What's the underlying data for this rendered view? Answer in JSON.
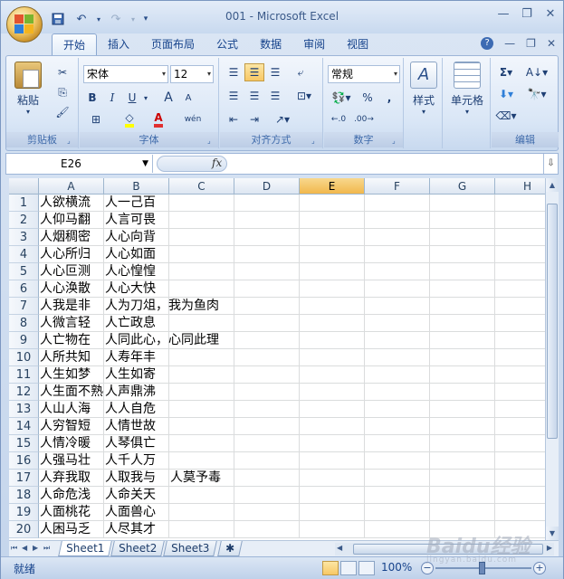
{
  "window": {
    "title": "001 - Microsoft Excel",
    "minimize": "—",
    "restore": "❐",
    "close": "✕"
  },
  "qat": {
    "save_icon": "save-icon",
    "undo_icon": "undo-icon",
    "redo_icon": "redo-icon",
    "customize_icon": "customize-icon"
  },
  "tabs": [
    "开始",
    "插入",
    "页面布局",
    "公式",
    "数据",
    "审阅",
    "视图"
  ],
  "active_tab": "开始",
  "tab_right": {
    "help": "?",
    "min": "—",
    "restore": "❐",
    "close": "✕"
  },
  "ribbon": {
    "clipboard": {
      "label": "剪贴板",
      "paste": "粘贴"
    },
    "font": {
      "label": "字体",
      "name": "宋体",
      "size": "12",
      "bold": "B",
      "italic": "I",
      "underline": "U",
      "grow": "A",
      "shrink": "A",
      "color_letter": "A",
      "wen": "wén"
    },
    "alignment": {
      "label": "对齐方式"
    },
    "number": {
      "label": "数字",
      "format": "常规",
      "percent": "%",
      "comma": ","
    },
    "styles": {
      "label": "样式"
    },
    "cells": {
      "label": "单元格"
    },
    "editing": {
      "label": "编辑",
      "sigma": "Σ"
    }
  },
  "formula_bar": {
    "name_box": "E26",
    "fx": "fx",
    "value": ""
  },
  "columns": [
    "A",
    "B",
    "C",
    "D",
    "E",
    "F",
    "G",
    "H"
  ],
  "selected_column": "E",
  "rows": [
    {
      "n": "1",
      "a": "人欲横流",
      "b": "人一己百"
    },
    {
      "n": "2",
      "a": "人仰马翻",
      "b": "人言可畏"
    },
    {
      "n": "3",
      "a": "人烟稠密",
      "b": "人心向背"
    },
    {
      "n": "4",
      "a": "人心所归",
      "b": "人心如面"
    },
    {
      "n": "5",
      "a": "人心叵测",
      "b": "人心惶惶"
    },
    {
      "n": "6",
      "a": "人心涣散",
      "b": "人心大快"
    },
    {
      "n": "7",
      "a": "人我是非",
      "b": "人为刀俎，我为鱼肉"
    },
    {
      "n": "8",
      "a": "人微言轻",
      "b": "人亡政息"
    },
    {
      "n": "9",
      "a": "人亡物在",
      "b": "人同此心，心同此理"
    },
    {
      "n": "10",
      "a": "人所共知",
      "b": "人寿年丰"
    },
    {
      "n": "11",
      "a": "人生如梦",
      "b": "人生如寄"
    },
    {
      "n": "12",
      "a": "人生面不熟",
      "b": "人声鼎沸"
    },
    {
      "n": "13",
      "a": "人山人海",
      "b": "人人自危"
    },
    {
      "n": "14",
      "a": "人穷智短",
      "b": "人情世故"
    },
    {
      "n": "15",
      "a": "人情冷暖",
      "b": "人琴俱亡"
    },
    {
      "n": "16",
      "a": "人强马壮",
      "b": "人千人万"
    },
    {
      "n": "17",
      "a": "人弃我取",
      "b": "人取我与",
      "c": "人莫予毒"
    },
    {
      "n": "18",
      "a": "人命危浅",
      "b": "人命关天"
    },
    {
      "n": "19",
      "a": "人面桃花",
      "b": "人面兽心"
    },
    {
      "n": "20",
      "a": "人困马乏",
      "b": "人尽其才"
    }
  ],
  "sheets": [
    "Sheet1",
    "Sheet2",
    "Sheet3"
  ],
  "active_sheet": "Sheet1",
  "status": {
    "text": "就绪",
    "zoom": "100%",
    "minus": "−",
    "plus": "+"
  },
  "watermark": {
    "brand": "Baidu经验",
    "sub": "jingyan.baidu.com"
  }
}
